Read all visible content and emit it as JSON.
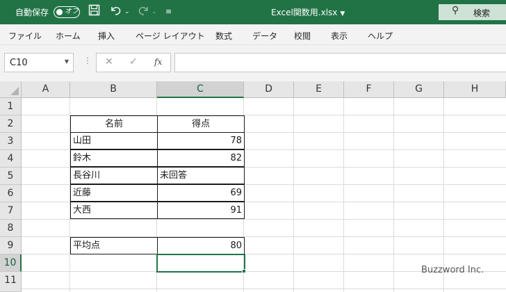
{
  "titlebar": {
    "autosave_label": "自動保存",
    "autosave_state": "オフ",
    "filename": "Excel関数用.xlsx",
    "search_label": "検索",
    "color": "#217346"
  },
  "ribbon": {
    "tabs": [
      "ファイル",
      "ホーム",
      "挿入",
      "ページ レイアウト",
      "数式",
      "データ",
      "校閲",
      "表示",
      "ヘルプ"
    ]
  },
  "formula_bar": {
    "name_box": "C10",
    "formula": ""
  },
  "grid": {
    "columns": [
      "A",
      "B",
      "C",
      "D",
      "E",
      "F",
      "G",
      "H"
    ],
    "rows": [
      "1",
      "2",
      "3",
      "4",
      "5",
      "6",
      "7",
      "8",
      "9",
      "10",
      "11"
    ],
    "selected_column": "C",
    "selected_row": "10"
  },
  "table": {
    "header_name": "名前",
    "header_score": "得点",
    "rows": [
      {
        "name": "山田",
        "score": "78"
      },
      {
        "name": "鈴木",
        "score": "82"
      },
      {
        "name": "長谷川",
        "score": "未回答"
      },
      {
        "name": "近藤",
        "score": "69"
      },
      {
        "name": "大西",
        "score": "91"
      }
    ],
    "average_label": "平均点",
    "average_value": "80"
  },
  "watermark": "Buzzword Inc."
}
